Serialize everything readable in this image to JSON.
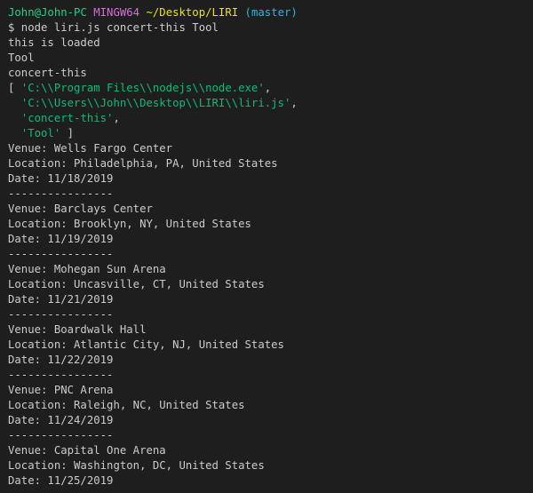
{
  "colors": {
    "background": "#1e1e1e",
    "text": "#cccccc",
    "user_host": "#23d18b",
    "system": "#d670d6",
    "path": "#e5e510",
    "branch": "#29b8db",
    "string": "#0dbc79"
  },
  "prompt": {
    "user_host": "John@John-PC",
    "system": "MINGW64",
    "path": "~/Desktop/LIRI",
    "branch": "(master)"
  },
  "command": "$ node liri.js concert-this Tool",
  "output": {
    "loaded": "this is loaded",
    "artist": "Tool",
    "command_name": "concert-this",
    "argv_open": "[",
    "argv": [
      "'C:\\\\Program Files\\\\nodejs\\\\node.exe'",
      "'C:\\\\Users\\\\John\\\\Desktop\\\\LIRI\\\\liri.js'",
      "'concert-this'",
      "'Tool'"
    ],
    "argv_comma": ",",
    "argv_close": " ]",
    "separator": "----------------",
    "events": [
      {
        "venue": "Venue: Wells Fargo Center",
        "location": "Location: Philadelphia, PA, United States",
        "date": "Date: 11/18/2019"
      },
      {
        "venue": "Venue: Barclays Center",
        "location": "Location: Brooklyn, NY, United States",
        "date": "Date: 11/19/2019"
      },
      {
        "venue": "Venue: Mohegan Sun Arena",
        "location": "Location: Uncasville, CT, United States",
        "date": "Date: 11/21/2019"
      },
      {
        "venue": "Venue: Boardwalk Hall",
        "location": "Location: Atlantic City, NJ, United States",
        "date": "Date: 11/22/2019"
      },
      {
        "venue": "Venue: PNC Arena",
        "location": "Location: Raleigh, NC, United States",
        "date": "Date: 11/24/2019"
      },
      {
        "venue": "Venue: Capital One Arena",
        "location": "Location: Washington, DC, United States",
        "date": "Date: 11/25/2019"
      }
    ]
  }
}
